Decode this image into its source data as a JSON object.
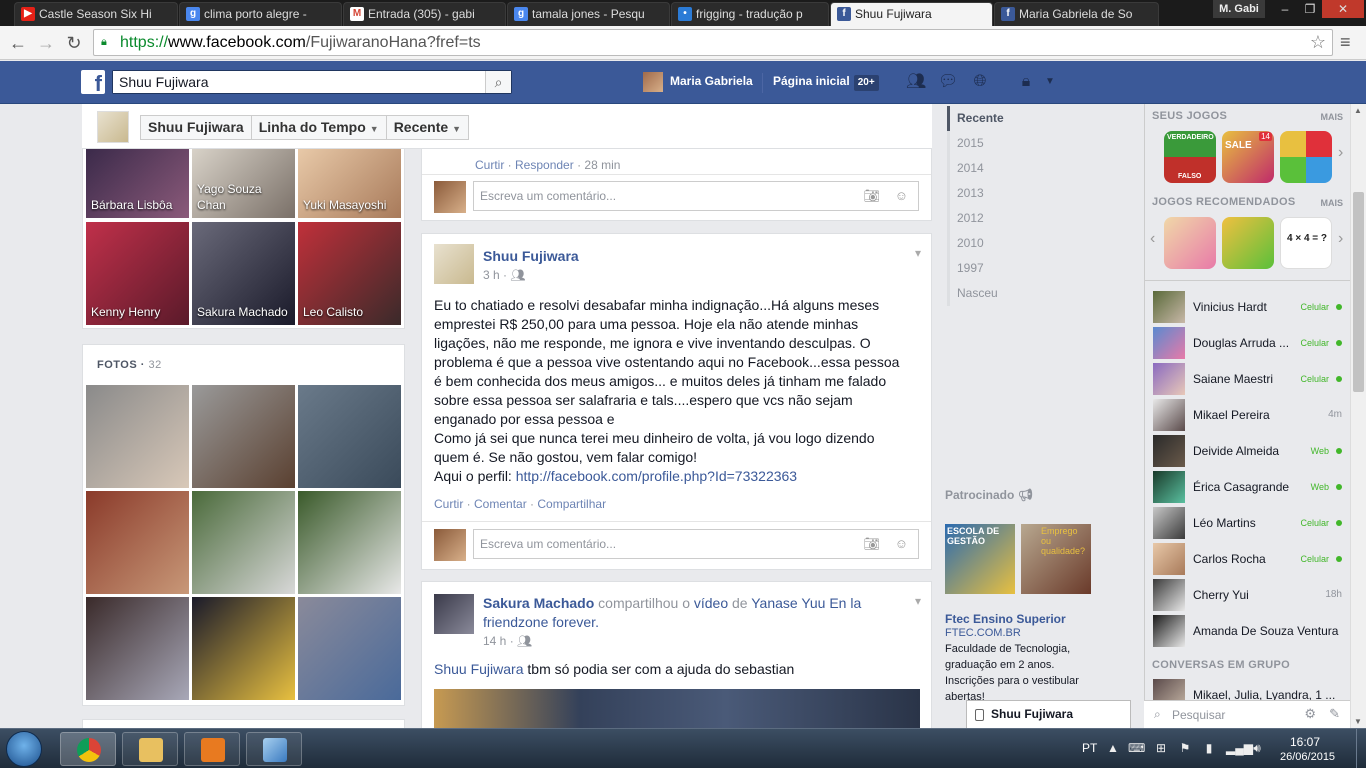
{
  "browser": {
    "tabs": [
      {
        "title": "Castle Season Six Hi",
        "icon": "youtube-icon",
        "color": "#e62117"
      },
      {
        "title": "clima porto alegre -",
        "icon": "google-icon",
        "color": "#4a87ee"
      },
      {
        "title": "Entrada (305) - gabi",
        "icon": "gmail-icon",
        "color": "#d54637"
      },
      {
        "title": "tamala jones - Pesqu",
        "icon": "google-icon",
        "color": "#4a87ee"
      },
      {
        "title": "frigging - tradução p",
        "icon": "translate-icon",
        "color": "#2b7bd6"
      },
      {
        "title": "Shuu Fujiwara",
        "icon": "facebook-icon",
        "color": "#3b5998"
      },
      {
        "title": "Maria Gabriela de So",
        "icon": "facebook-icon",
        "color": "#3b5998"
      }
    ],
    "user_badge": "M. Gabi",
    "url_scheme": "https://",
    "url_host": "www.facebook.com",
    "url_path": "/FujiwaranoHana?fref=ts"
  },
  "fbbar": {
    "search_value": "Shuu Fujiwara",
    "user_name": "Maria Gabriela",
    "home_label": "Página inicial",
    "home_count": "20+"
  },
  "timeline_header": {
    "name": "Shuu Fujiwara",
    "timeline": "Linha do Tempo",
    "recent": "Recente"
  },
  "friends": [
    {
      "name": "Bárbara Lisbôa",
      "bg": "linear-gradient(135deg,#3b2a4a,#8b5a7a)"
    },
    {
      "name": "Yago Souza Chan",
      "bg": "linear-gradient(135deg,#d8d2c8,#7a7068)"
    },
    {
      "name": "Yuki Masayoshi",
      "bg": "linear-gradient(135deg,#e8c9a8,#a87a5a)"
    },
    {
      "name": "Kenny Henry",
      "bg": "linear-gradient(135deg,#c0304a,#5a1a2a)"
    },
    {
      "name": "Sakura Machado",
      "bg": "linear-gradient(135deg,#6a6a7a,#1a1a2a)"
    },
    {
      "name": "Leo Calisto",
      "bg": "linear-gradient(135deg,#c0303a,#3a2a2a)"
    }
  ],
  "photos": {
    "title": "FOTOS",
    "count": "32",
    "tiles": [
      "linear-gradient(135deg,#8a8a8a,#d8c8b8)",
      "linear-gradient(135deg,#9a9a9a,#5a4030)",
      "linear-gradient(135deg,#6a7a8a,#3a4a5a)",
      "linear-gradient(135deg,#8a3a2a,#c89878)",
      "linear-gradient(135deg,#4a6a3a,#d8d8d8)",
      "linear-gradient(135deg,#3a5a2a,#e8e8e8)",
      "linear-gradient(135deg,#3a2a2a,#a8a8b8)",
      "linear-gradient(135deg,#1a1a2a,#e8c040)",
      "linear-gradient(135deg,#8a8a9a,#4a6a9a)"
    ]
  },
  "feed": {
    "top_actions": {
      "like": "Curtir",
      "reply": "Responder",
      "time": "28 min"
    },
    "comment_placeholder": "Escreva um comentário...",
    "post1": {
      "author": "Shuu Fujiwara",
      "time": "3 h",
      "text": "Eu to chatiado e resolvi desabafar minha indignação...Há alguns meses emprestei R$ 250,00 para uma pessoa. Hoje ela não atende minhas ligações, não me responde, me ignora e vive inventando desculpas. O problema é que a pessoa vive ostentando aqui no Facebook...essa pessoa é bem conhecida dos meus amigos... e muitos deles já tinham me falado sobre essa pessoa ser salafraria e tals....espero que vcs não sejam enganado por essa pessoa e",
      "text2": "Como já sei que nunca terei meu dinheiro de volta, já vou logo dizendo quem é. Se não gostou, vem falar comigo!",
      "profile_prefix": "Aqui o perfil:",
      "profile_link": "http://facebook.com/profile.php?Id=73322363",
      "like": "Curtir",
      "comment": "Comentar",
      "share": "Compartilhar"
    },
    "post2": {
      "author": "Sakura Machado",
      "shared_word": "compartilhou o",
      "video_word": "vídeo",
      "of_word": "de",
      "video_owner": "Yanase Yuu En la friendzone forever.",
      "time": "14 h",
      "mention": "Shuu Fujiwara",
      "text": "tbm só podia ser com a ajuda do sebastian"
    }
  },
  "years": [
    "Recente",
    "2015",
    "2014",
    "2013",
    "2012",
    "2010",
    "1997",
    "Nasceu"
  ],
  "sponsored": {
    "title": "Patrocinado",
    "ad_title": "Ftec Ensino Superior",
    "ad_url": "FTEC.COM.BR",
    "ad_body": "Faculdade de Tecnologia, graduação em 2 anos. Inscrições para o vestibular abertas!",
    "img1_text": "ESCOLA DE GESTÃO",
    "img2_text": "Emprego ou qualidade?"
  },
  "sidebar": {
    "games_title": "SEUS JOGOS",
    "games_more": "MAIS",
    "rec_title": "JOGOS RECOMENDADOS",
    "rec_more": "MAIS",
    "game1_top": "VERDADEIRO",
    "game1_bottom": "FALSO",
    "game2_label": "SALE",
    "game2_badge": "14",
    "math_text": "4 × 4 = ?",
    "friends": [
      {
        "name": "Vinicius Hardt",
        "status": "Celular",
        "online": true
      },
      {
        "name": "Douglas Arruda ...",
        "status": "Celular",
        "online": true
      },
      {
        "name": "Saiane Maestri",
        "status": "Celular",
        "online": true
      },
      {
        "name": "Mikael Pereira",
        "status": "4m",
        "online": false
      },
      {
        "name": "Deivide Almeida",
        "status": "Web",
        "online": true
      },
      {
        "name": "Érica Casagrande",
        "status": "Web",
        "online": true
      },
      {
        "name": "Léo Martins",
        "status": "Celular",
        "online": true
      },
      {
        "name": "Carlos Rocha",
        "status": "Celular",
        "online": true
      },
      {
        "name": "Cherry Yui",
        "status": "18h",
        "online": false
      },
      {
        "name": "Amanda De Souza Ventura",
        "status": "",
        "online": false
      }
    ],
    "group_title": "CONVERSAS EM GRUPO",
    "group_name": "Mikael, Julia, Lyandra, 1 ...",
    "search_placeholder": "Pesquisar"
  },
  "chat_tab": "Shuu Fujiwara",
  "taskbar": {
    "lang": "PT",
    "time": "16:07",
    "date": "26/06/2015"
  }
}
